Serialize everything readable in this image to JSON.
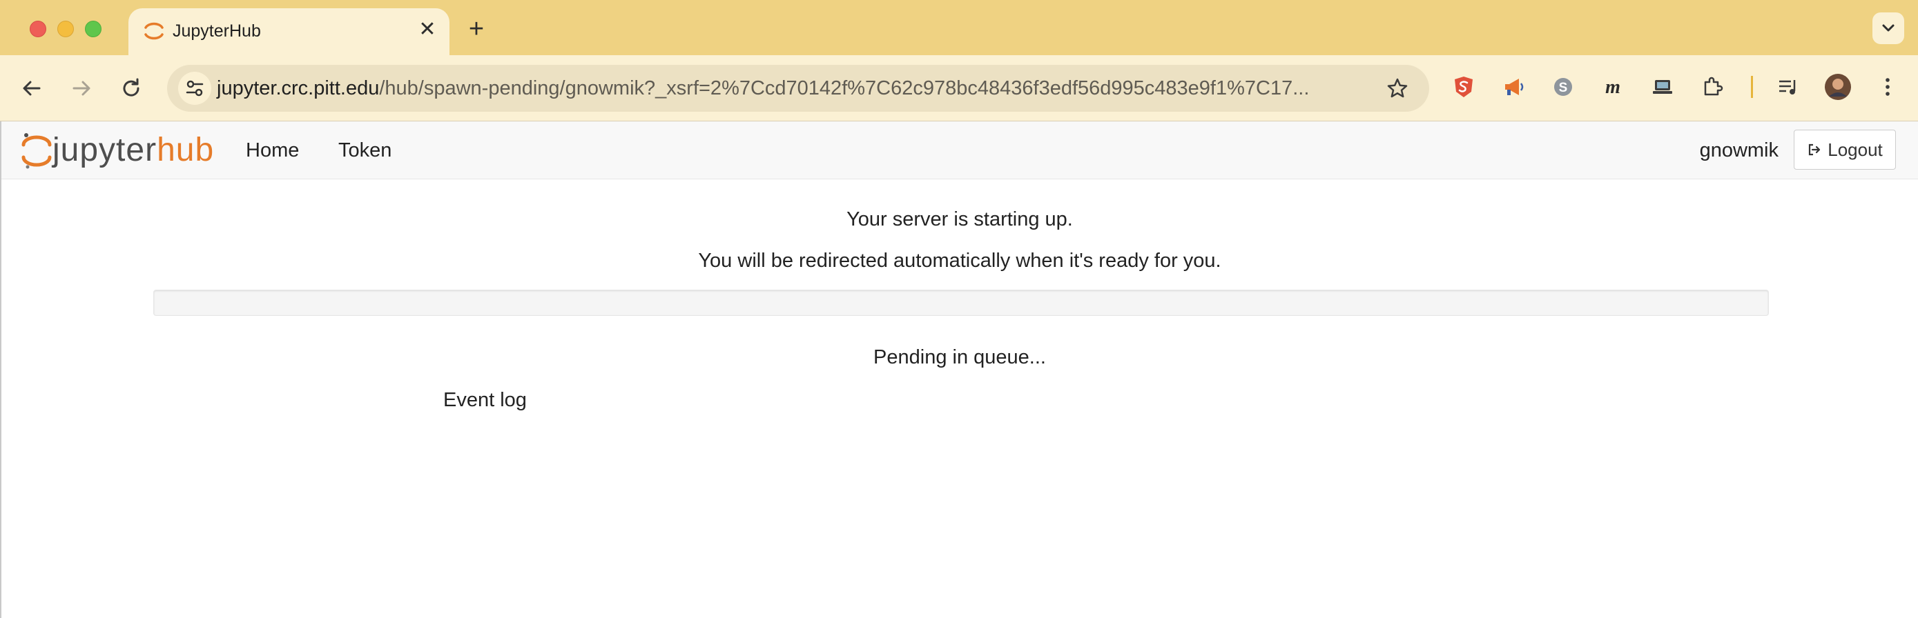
{
  "browser": {
    "tab": {
      "title": "JupyterHub",
      "close_glyph": "✕"
    },
    "new_tab_glyph": "+",
    "address": {
      "domain": "jupyter.crc.pitt.edu",
      "path": "/hub/spawn-pending/gnowmik?_xsrf=2%7Ccd70142f%7C62c978bc48436f3edf56d995c483e9f1%7C17..."
    }
  },
  "navbar": {
    "logo": {
      "left": "jupyter",
      "right": "hub"
    },
    "links": [
      "Home",
      "Token"
    ],
    "username": "gnowmik",
    "logout_label": "Logout"
  },
  "main": {
    "line1": "Your server is starting up.",
    "line2": "You will be redirected automatically when it's ready for you.",
    "progress_fraction": 0,
    "status": "Pending in queue...",
    "event_log_label": "Event log"
  },
  "colors": {
    "brand_orange": "#e67c2a",
    "tabstrip": "#efd282",
    "toolbar": "#fbf1d4"
  }
}
